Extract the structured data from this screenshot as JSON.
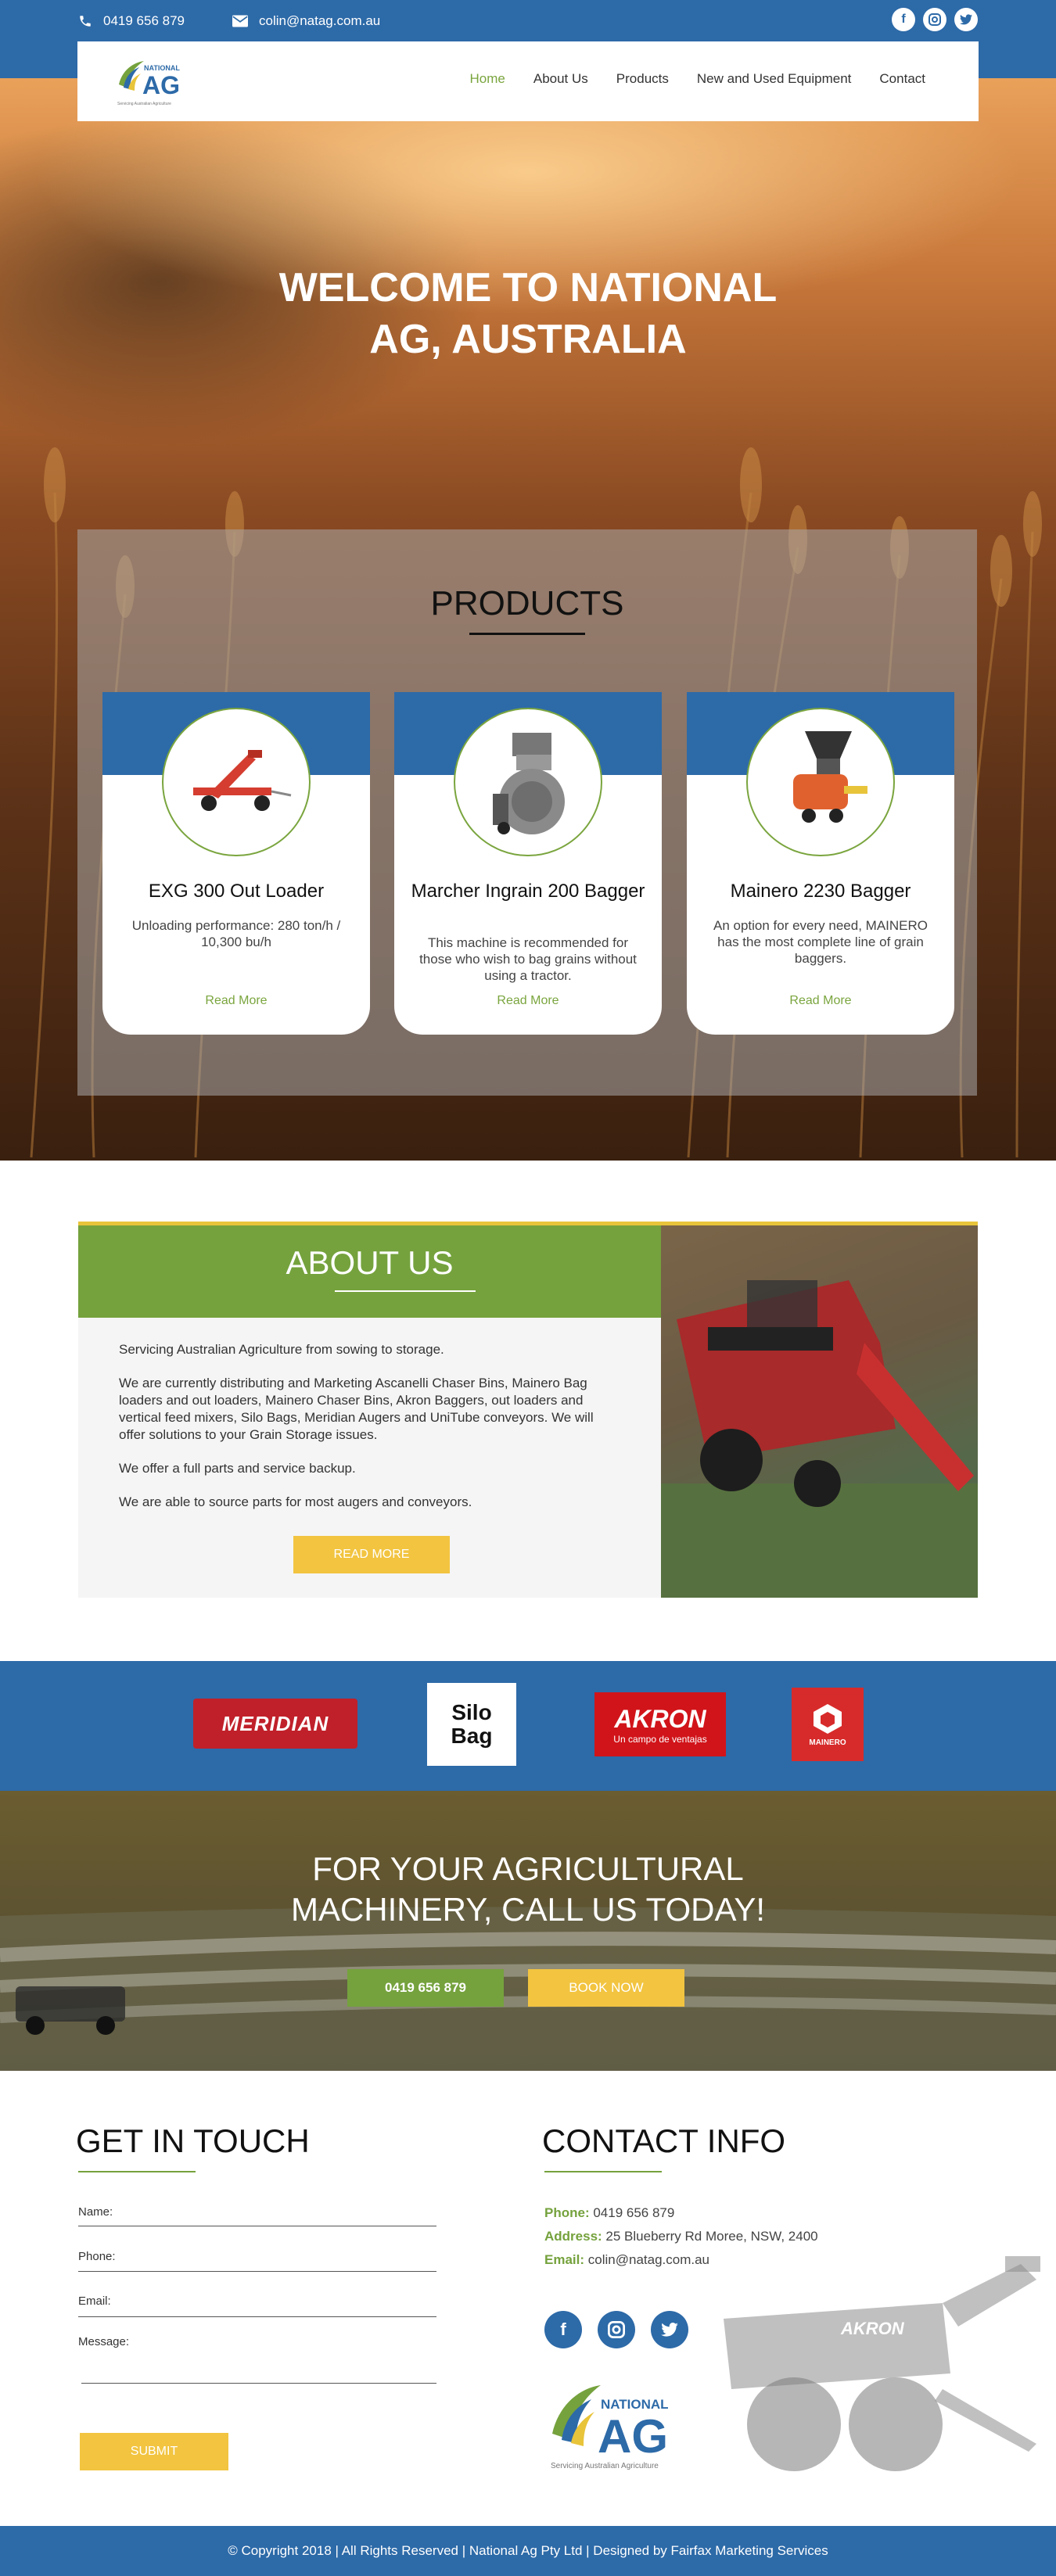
{
  "topbar": {
    "phone": "0419 656 879",
    "email": "colin@natag.com.au",
    "social": [
      "facebook-icon",
      "instagram-icon",
      "twitter-icon"
    ]
  },
  "nav": {
    "logo_text_top": "NATIONAL",
    "logo_text_main": "AG",
    "logo_tagline": "Servicing Australian Agriculture",
    "items": [
      {
        "label": "Home",
        "active": true
      },
      {
        "label": "About Us",
        "active": false
      },
      {
        "label": "Products",
        "active": false
      },
      {
        "label": "New and Used Equipment",
        "active": false
      },
      {
        "label": "Contact",
        "active": false
      }
    ]
  },
  "hero": {
    "title_line1": "WELCOME TO NATIONAL",
    "title_line2": "AG, AUSTRALIA"
  },
  "products": {
    "title": "PRODUCTS",
    "cards": [
      {
        "title": "EXG 300 Out Loader",
        "desc": "Unloading performance: 280 ton/h / 10,300 bu/h",
        "more": "Read More"
      },
      {
        "title": "Marcher Ingrain 200 Bagger",
        "desc": "This machine is recommended for those who wish to bag grains without using a tractor.",
        "more": "Read More"
      },
      {
        "title": "Mainero 2230 Bagger",
        "desc": "An option for every need, MAINERO has the most complete line of grain baggers.",
        "more": "Read More"
      }
    ]
  },
  "about": {
    "title": "ABOUT US",
    "p1": "Servicing Australian Agriculture from sowing to storage.",
    "p2": "We are currently distributing and Marketing Ascanelli Chaser Bins, Mainero Bag loaders and out loaders, Mainero Chaser Bins, Akron Baggers, out loaders and vertical feed mixers, Silo Bags, Meridian Augers and UniTube conveyors. We will offer solutions to your Grain Storage issues.",
    "p3": "We offer a full parts and service backup.",
    "p4": "We are able to source parts for most augers and conveyors.",
    "button": "READ MORE"
  },
  "brands": {
    "meridian": "MERIDIAN",
    "silobag_1": "Silo",
    "silobag_2": "Bag",
    "akron": "AKRON",
    "akron_sub": "Un campo de ventajas",
    "mainero": "MAINERO"
  },
  "cta": {
    "line1": "FOR YOUR AGRICULTURAL",
    "line2": "MACHINERY, CALL US TODAY!",
    "phone_button": "0419 656 879",
    "book_button": "BOOK NOW"
  },
  "contact_form": {
    "title": "GET IN TOUCH",
    "name_label": "Name:",
    "phone_label": "Phone:",
    "email_label": "Email:",
    "message_label": "Message:",
    "submit": "SUBMIT"
  },
  "contact_info": {
    "title": "CONTACT INFO",
    "phone_label": "Phone:",
    "phone": "0419 656 879",
    "address_label": "Address:",
    "address": "25 Blueberry Rd Moree, NSW, 2400",
    "email_label": "Email:",
    "email": "colin@natag.com.au",
    "social": [
      "facebook-icon",
      "instagram-icon",
      "twitter-icon"
    ],
    "bin_brand": "AKRON"
  },
  "footer": {
    "text": "© Copyright 2018 | All Rights Reserved | National Ag Pty Ltd | Designed by Fairfax Marketing Services"
  },
  "colors": {
    "brand_blue": "#2d6aa8",
    "brand_green": "#75a23d",
    "brand_yellow": "#f2c440"
  }
}
